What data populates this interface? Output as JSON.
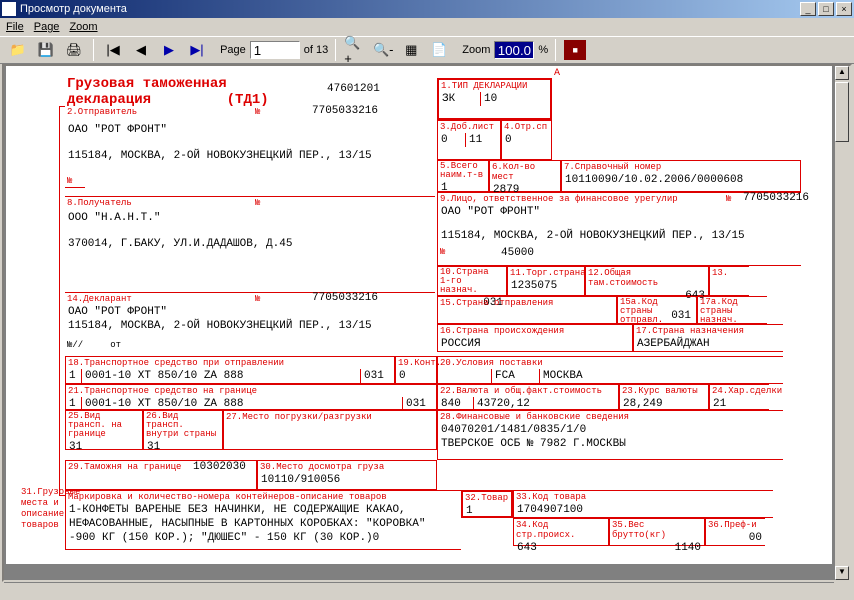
{
  "window": {
    "title": "Просмотр документа"
  },
  "menu": {
    "file": "File",
    "page": "Page",
    "zoom": "Zoom"
  },
  "toolbar": {
    "page_label": "Page",
    "page_val": "1",
    "page_total": "of 13",
    "zoom_label": "Zoom",
    "zoom_val": "100.0",
    "zoom_pct": "%"
  },
  "doc": {
    "title1": "Грузовая таможенная",
    "title2": "декларация",
    "title3": "(ТД1)",
    "num": "47601201",
    "a": "А"
  },
  "f1": {
    "lbl": "1.ТИП ДЕКЛАРАЦИИ",
    "v1": "ЗК",
    "v2": "10"
  },
  "f2": {
    "lbl": "2.Отправитель",
    "nlbl": "№",
    "n": "7705033216",
    "name": "ОАО \"РОТ ФРОНТ\"",
    "addr": "115184, МОСКВА, 2-ОЙ НОВОКУЗНЕЦКИЙ ПЕР., 13/15"
  },
  "f3": {
    "lbl": "3.Доб.лист",
    "v1": "0",
    "v2": "11"
  },
  "f4": {
    "lbl": "4.Отр.сп",
    "v": "0"
  },
  "f5": {
    "lbl": "5.Всего наим.т-в",
    "v": "1"
  },
  "f6": {
    "lbl": "6.Кол-во мест",
    "v": "2879"
  },
  "f7": {
    "lbl": "7.Справочный номер",
    "v": "10110090/10.02.2006/0000608"
  },
  "f8": {
    "lbl": "8.Получатель",
    "nlbl": "№",
    "name": "ООО \"Н.А.Н.Т.\"",
    "addr": "370014, Г.БАКУ, УЛ.И.ДАДАШОВ, Д.45"
  },
  "f9": {
    "lbl": "9.Лицо, ответственное за финансовое урегулир",
    "nlbl": "№",
    "n": "7705033216",
    "name": "ОАО \"РОТ ФРОНТ\"",
    "addr": "115184, МОСКВА, 2-ОЙ НОВОКУЗНЕЦКИЙ ПЕР., 13/15",
    "nn": "№",
    "nnv": "45000"
  },
  "f10": {
    "lbl": "10.Страна 1-го назнач.",
    "v": "031"
  },
  "f11": {
    "lbl": "11.Торг.страна",
    "v": "1235075"
  },
  "f12": {
    "lbl": "12.Общая там.стоимость",
    "v": "643"
  },
  "f13": {
    "lbl": "13."
  },
  "f14": {
    "lbl": "14.Декларант",
    "nlbl": "№",
    "n": "7705033216",
    "name": "ОАО \"РОТ ФРОНТ\"",
    "addr": "115184, МОСКВА, 2-ОЙ НОВОКУЗНЕЦКИЙ ПЕР., 13/15",
    "bot": "№//",
    "bot2": "от"
  },
  "f15": {
    "lbl": "15.Страна отправления"
  },
  "f15a": {
    "lbl": "15а.Код страны отправл.",
    "v": "031"
  },
  "f16": {
    "lbl": "16.Страна происхождения",
    "v": "РОССИЯ"
  },
  "f17": {
    "lbl": "17.Страна назначения",
    "v": "АЗЕРБАЙДЖАН"
  },
  "f17a": {
    "lbl": "17а.Код страны назнач."
  },
  "f18": {
    "lbl": "18.Транспортное средство при отправлении",
    "v1": "1",
    "v2": "0001-10 ХТ 850/10 ZA 888",
    "v3": "031"
  },
  "f19": {
    "lbl": "19.Конт.",
    "v": "0"
  },
  "f20": {
    "lbl": "20.Условия поставки",
    "v1": "FCA",
    "v2": "МОСКВА"
  },
  "f21": {
    "lbl": "21.Транспортное средство на границе",
    "v1": "1",
    "v2": "0001-10 ХТ 850/10 ZA 888",
    "v3": "031"
  },
  "f22": {
    "lbl": "22.Валюта и общ.факт.стоимость",
    "v1": "840",
    "v2": "43720,12"
  },
  "f23": {
    "lbl": "23.Курс валюты",
    "v": "28,249"
  },
  "f24": {
    "lbl": "24.Хар.сделки",
    "v": "21"
  },
  "f25": {
    "lbl": "25.Вид трансп. на границе",
    "v": "31"
  },
  "f26": {
    "lbl": "26.Вид трансп. внутри страны",
    "v": "31"
  },
  "f27": {
    "lbl": "27.Место погрузки/разгрузки"
  },
  "f28": {
    "lbl": "28.Финансовые и банковские сведения",
    "l1": "04070201/1481/0835/1/0",
    "l2": "ТВЕРСКОЕ ОСБ № 7982 Г.МОСКВЫ"
  },
  "f29": {
    "lbl": "29.Таможня на границе",
    "v": "10302030"
  },
  "f30": {
    "lbl": "30.Место досмотра груза",
    "v": "10110/910056"
  },
  "f31": {
    "side": "31.Грузовые места и описание товаров",
    "lbl": "Маркировка и количество-номера контейнеров-описание товаров",
    "l1": "1-КОНФЕТЫ ВАРЕНЫЕ БЕЗ НАЧИНКИ, НЕ СОДЕРЖАЩИЕ КАКАО,",
    "l2": "НЕФАСОВАННЫЕ, НАСЫПНЫЕ В КАРТОННЫХ КОРОБКАХ: \"КОРОВКА\"",
    "l3": "-900 КГ (150 КОР.); \"ДЮШЕС\" - 150 КГ (30 КОР.)0"
  },
  "f32": {
    "lbl": "32.Товар",
    "v": "1"
  },
  "f33": {
    "lbl": "33.Код товара",
    "v": "1704907100"
  },
  "f34": {
    "lbl": "34.Код стр.происх.",
    "v": "643"
  },
  "f35": {
    "lbl": "35.Вес брутто(кг)",
    "v": "1140"
  },
  "f36": {
    "lbl": "36.Преф-и",
    "v": "00"
  }
}
